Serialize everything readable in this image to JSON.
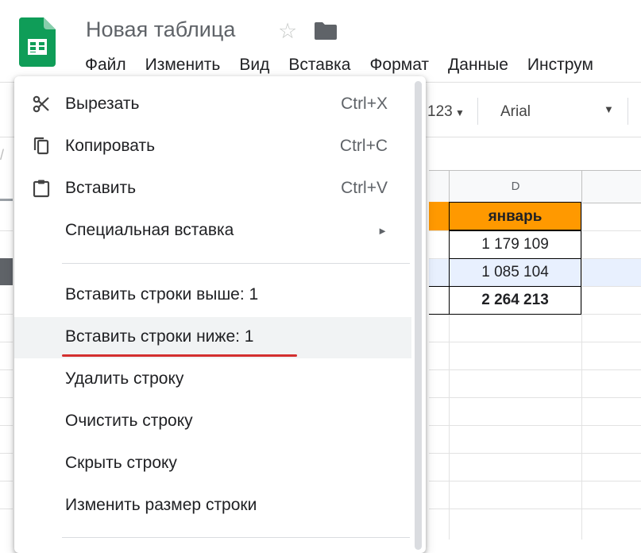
{
  "header": {
    "doc_title": "Новая таблица",
    "star_icon": "star-outline-icon",
    "folder_icon": "folder-icon",
    "menu": [
      "Файл",
      "Изменить",
      "Вид",
      "Вставка",
      "Формат",
      "Данные",
      "Инструм"
    ]
  },
  "toolbar": {
    "number_format": "123",
    "font": "Arial"
  },
  "grid": {
    "column_D": "D",
    "cells": {
      "header_value": "январь",
      "row1": "1 179 109",
      "row2": "1 085 104",
      "total": "2 264 213"
    }
  },
  "context_menu": {
    "items": [
      {
        "label": "Вырезать",
        "shortcut": "Ctrl+X",
        "icon": "scissors-icon"
      },
      {
        "label": "Копировать",
        "shortcut": "Ctrl+C",
        "icon": "copy-icon"
      },
      {
        "label": "Вставить",
        "shortcut": "Ctrl+V",
        "icon": "clipboard-icon"
      },
      {
        "label": "Специальная вставка",
        "icon": "submenu-arrow-icon"
      },
      {
        "label": "Вставить строки выше: 1"
      },
      {
        "label": "Вставить строки ниже: 1"
      },
      {
        "label": "Удалить строку"
      },
      {
        "label": "Очистить строку"
      },
      {
        "label": "Скрыть строку"
      },
      {
        "label": "Изменить размер строки"
      }
    ],
    "highlight_color": "#d32f2f"
  },
  "colors": {
    "accent_orange": "#ff9900",
    "sheets_green": "#0f9d58"
  }
}
